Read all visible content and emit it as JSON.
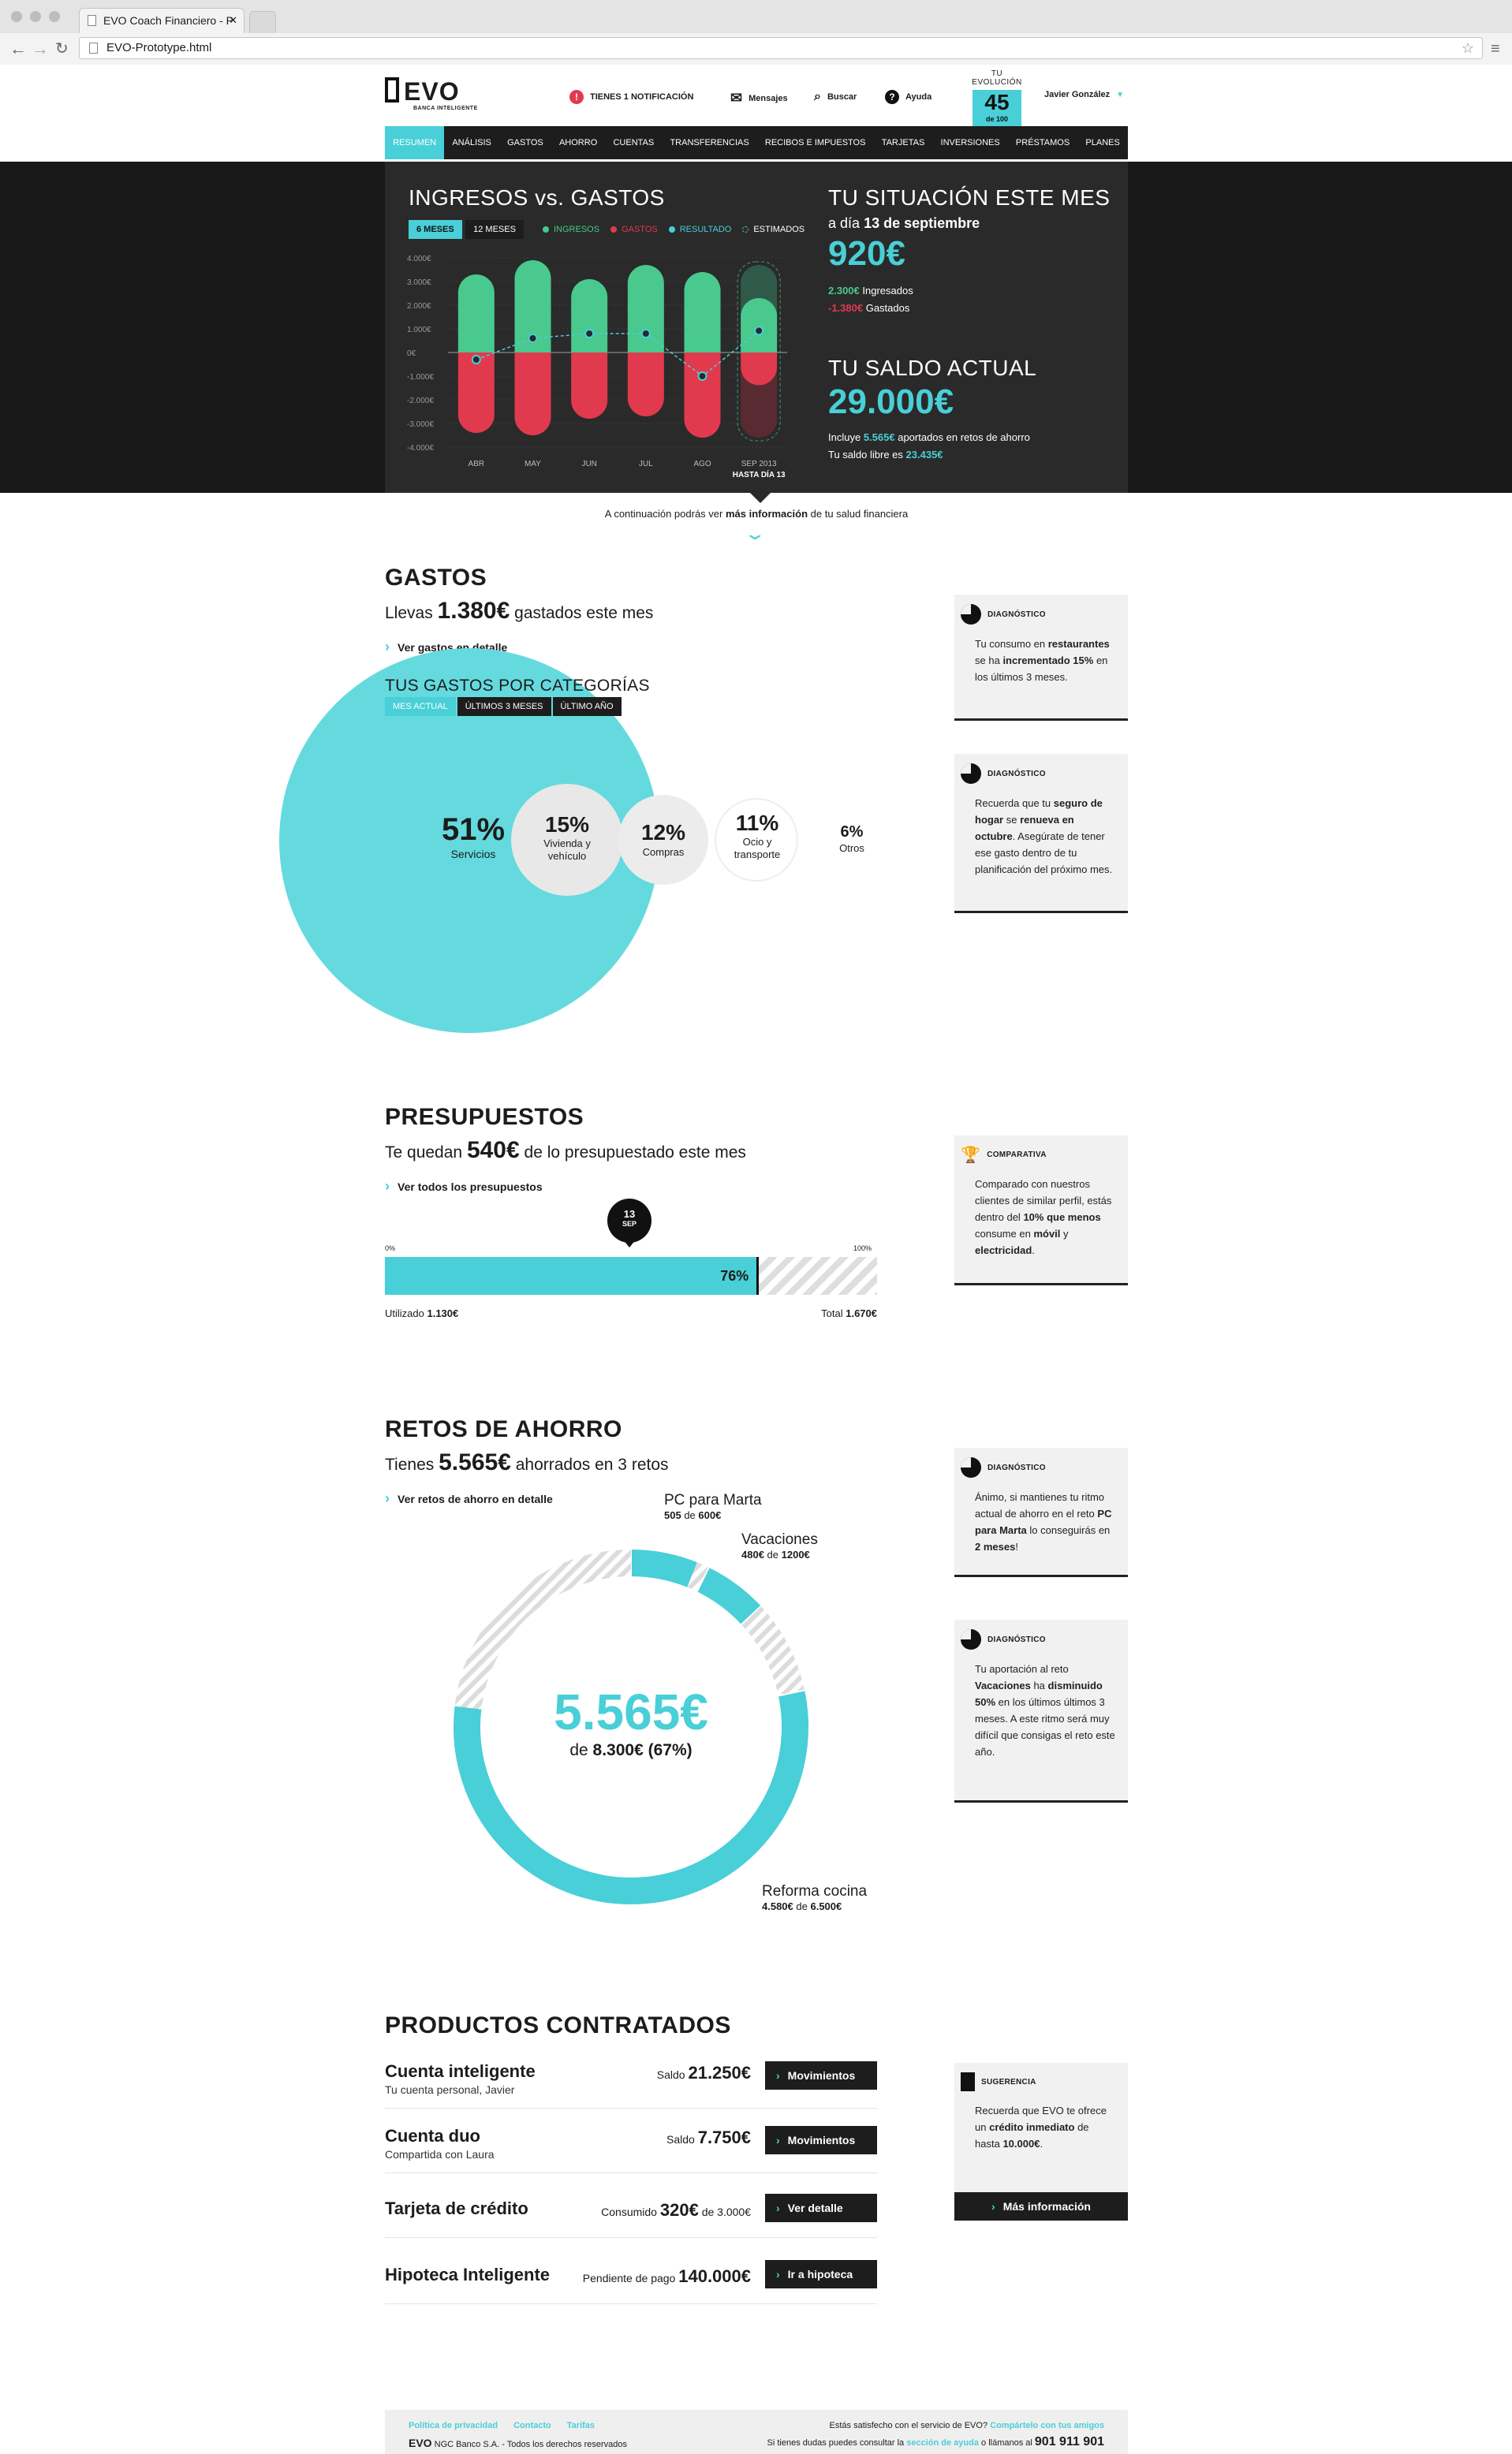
{
  "browser": {
    "tab_title": "EVO Coach Financiero - P",
    "url": "EVO-Prototype.html"
  },
  "header": {
    "logo": "EVO",
    "logo_sub": "BANCA INTELIGENTE",
    "notification": "TIENES 1 NOTIFICACIÓN",
    "messages": "Mensajes",
    "search": "Buscar",
    "help": "Ayuda",
    "evolution_label": "TU EVOLUCIÓN",
    "evolution_score": "45",
    "evolution_of": "de 100",
    "user": "Javier González"
  },
  "nav": [
    "RESUMEN",
    "ANÁLISIS",
    "GASTOS",
    "AHORRO",
    "CUENTAS",
    "TRANSFERENCIAS",
    "RECIBOS E IMPUESTOS",
    "TARJETAS",
    "INVERSIONES",
    "PRÉSTAMOS",
    "PLANES"
  ],
  "hero": {
    "chart_title": "INGRESOS vs. GASTOS",
    "range_6": "6 MESES",
    "range_12": "12 MESES",
    "legend": {
      "income": "INGRESOS",
      "expenses": "GASTOS",
      "result": "RESULTADO",
      "estimated": "ESTIMADOS"
    },
    "month_title": "TU SITUACIÓN ESTE MES",
    "month_date_prefix": "a día",
    "month_date": "13 de septiembre",
    "month_total": "920€",
    "month_income": "2.300€",
    "month_income_label": "Ingresados",
    "month_expenses": "-1.380€",
    "month_expenses_label": "Gastados",
    "balance_title": "TU SALDO ACTUAL",
    "balance": "29.000€",
    "balance_note_1": "Incluye",
    "balance_saved": "5.565€",
    "balance_note_2": "aportados en retos de ahorro",
    "free_label": "Tu saldo libre es",
    "free_value": "23.435€",
    "continue_1": "A continuación podrás ver",
    "continue_bold": "más información",
    "continue_2": "de tu salud financiera",
    "sep_label_2": "HASTA DÍA 13"
  },
  "chart_data": {
    "type": "bar",
    "categories": [
      "ABR",
      "MAY",
      "JUN",
      "JUL",
      "AGO",
      "SEP 2013"
    ],
    "series": [
      {
        "name": "INGRESOS",
        "values": [
          3300,
          3900,
          3100,
          3700,
          3400,
          2300
        ]
      },
      {
        "name": "GASTOS",
        "values": [
          -3400,
          -3500,
          -2800,
          -2700,
          -3600,
          -1380
        ]
      },
      {
        "name": "RESULTADO",
        "values": [
          -300,
          600,
          800,
          800,
          -1000,
          920
        ]
      }
    ],
    "estimated_last": {
      "income": 3700,
      "expenses": -3600
    },
    "yticks": [
      "4.000€",
      "3.000€",
      "2.000€",
      "1.000€",
      "0€",
      "-1.000€",
      "-2.000€",
      "-3.000€",
      "-4.000€"
    ],
    "ylim": [
      -4000,
      4000
    ],
    "colors": {
      "income": "#49c98e",
      "expenses": "#e13a4e",
      "result": "#49cfd7"
    }
  },
  "gastos": {
    "title": "GASTOS",
    "sub_1": "Llevas",
    "amount": "1.380€",
    "sub_2": "gastados este mes",
    "link": "Ver gastos en detalle",
    "cat_title": "TUS GASTOS POR CATEGORÍAS",
    "tabs": [
      "MES ACTUAL",
      "ÚLTIMOS 3 MESES",
      "ÚLTIMO AÑO"
    ],
    "categories": [
      {
        "pct": "51%",
        "label": "Servicios"
      },
      {
        "pct": "15%",
        "label": "Vivienda y vehículo"
      },
      {
        "pct": "12%",
        "label": "Compras"
      },
      {
        "pct": "11%",
        "label": "Ocio y transporte"
      },
      {
        "pct": "6%",
        "label": "Otros"
      }
    ],
    "card1": {
      "title": "DIAGNÓSTICO",
      "t1": "Tu consumo en",
      "b1": "restaurantes",
      "t2": "se ha",
      "b2": "incrementado 15%",
      "t3": "en los últimos 3 meses."
    },
    "card2": {
      "title": "DIAGNÓSTICO",
      "t1": "Recuerda que tu",
      "b1": "seguro de hogar",
      "t2": "se",
      "b2": "renueva en octubre",
      "t3": ". Asegúrate de tener ese gasto dentro de tu planificación del próximo mes."
    }
  },
  "presupuestos": {
    "title": "PRESUPUESTOS",
    "sub_1": "Te quedan",
    "amount": "540€",
    "sub_2": "de lo presupuestado este mes",
    "link": "Ver todos los presupuestos",
    "pin_day": "13",
    "pin_month": "SEP",
    "min": "0%",
    "max": "100%",
    "progress_pct": 76,
    "progress_label": "76%",
    "used_label": "Utilizado",
    "used": "1.130€",
    "total_label": "Total",
    "total": "1.670€",
    "card": {
      "title": "COMPARATIVA",
      "t1": "Comparado con nuestros clientes de similar perfil, estás dentro del",
      "b1": "10% que menos",
      "t2": "consume en",
      "b2": "móvil",
      "t3": "y",
      "b3": "electricidad",
      "t4": "."
    }
  },
  "ahorro": {
    "title": "RETOS DE AHORRO",
    "sub_1": "Tienes",
    "amount": "5.565€",
    "sub_2": "ahorrados en 3 retos",
    "link": "Ver retos de ahorro en detalle",
    "center_value": "5.565€",
    "center_sub_1": "de",
    "center_sub_2": "8.300€ (67%)",
    "goals": [
      {
        "name": "PC para Marta",
        "saved": "505",
        "of": "de",
        "target": "600€",
        "saved_value": 505,
        "target_value": 600
      },
      {
        "name": "Vacaciones",
        "saved": "480€",
        "of": "de",
        "target": "1200€",
        "saved_value": 480,
        "target_value": 1200
      },
      {
        "name": "Reforma cocina",
        "saved": "4.580€",
        "of": "de",
        "target": "6.500€",
        "saved_value": 4580,
        "target_value": 6500
      }
    ],
    "card1": {
      "title": "DIAGNÓSTICO",
      "t1": "Ánimo, si mantienes tu ritmo actual de ahorro en el reto",
      "b1": "PC para Marta",
      "t2": "lo conseguirás en",
      "b2": "2 meses",
      "t3": "!"
    },
    "card2": {
      "title": "DIAGNÓSTICO",
      "t1": "Tu aportación al reto",
      "b1": "Vacaciones",
      "t2": "ha",
      "b2": "disminuido 50%",
      "t3": "en los últimos últimos 3 meses. A este ritmo será muy difícil que consigas el reto este año."
    }
  },
  "productos": {
    "title": "PRODUCTOS CONTRATADOS",
    "items": [
      {
        "name": "Cuenta inteligente",
        "desc": "Tu cuenta personal, Javier",
        "val_label": "Saldo",
        "value": "21.250€",
        "extra": "",
        "button": "Movimientos"
      },
      {
        "name": "Cuenta duo",
        "desc": "Compartida con Laura",
        "val_label": "Saldo",
        "value": "7.750€",
        "extra": "",
        "button": "Movimientos"
      },
      {
        "name": "Tarjeta de crédito",
        "desc": "",
        "val_label": "Consumido",
        "value": "320€",
        "extra": "de 3.000€",
        "button": "Ver detalle"
      },
      {
        "name": "Hipoteca Inteligente",
        "desc": "",
        "val_label": "Pendiente de pago",
        "value": "140.000€",
        "extra": "",
        "button": "Ir a hipoteca"
      }
    ],
    "card": {
      "title": "SUGERENCIA",
      "t1": "Recuerda que EVO te ofrece un",
      "b1": "crédito inmediato",
      "t2": "de hasta",
      "b2": "10.000€",
      "t3": ".",
      "button": "Más información"
    }
  },
  "footer": {
    "links": [
      "Política de privacidad",
      "Contacto",
      "Tarifas"
    ],
    "brand": "EVO",
    "legal": "NGC Banco S.A. - Todos los derechos reservados",
    "q1": "Estás satisfecho con el servicio de EVO?",
    "q1_link": "Compártelo con tus amigos",
    "q2": "Si tienes dudas puedes consultar la",
    "q2_link": "sección de ayuda",
    "q2b": "o llámanos al",
    "phone": "901 911 901"
  }
}
